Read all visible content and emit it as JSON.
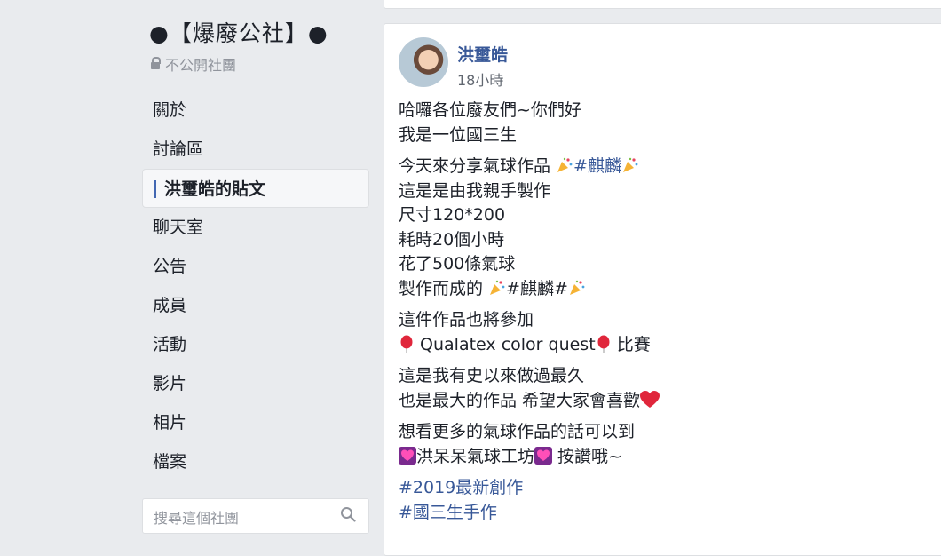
{
  "group": {
    "title": "●【爆廢公社】●",
    "privacy": "不公開社團"
  },
  "nav": {
    "items": [
      {
        "label": "關於"
      },
      {
        "label": "討論區"
      },
      {
        "label": "洪璽皓的貼文",
        "active": true
      },
      {
        "label": "聊天室"
      },
      {
        "label": "公告"
      },
      {
        "label": "成員"
      },
      {
        "label": "活動"
      },
      {
        "label": "影片"
      },
      {
        "label": "相片"
      },
      {
        "label": "檔案"
      }
    ]
  },
  "search": {
    "placeholder": "搜尋這個社團"
  },
  "post": {
    "author": "洪璽皓",
    "time": "18小時",
    "lines": {
      "l1": "哈囉各位廢友們~你們好",
      "l2": "我是一位國三生",
      "l3a": "今天來分享氣球作品 ",
      "l3b": "#麒麟",
      "l4": "這是是由我親手製作",
      "l5": "尺寸120*200",
      "l6": "耗時20個小時",
      "l7": "花了500條氣球",
      "l8a": "製作而成的 ",
      "l8b": "#麒麟#",
      "l9": "這件作品也將參加",
      "l10a": " Qualatex color quest",
      "l10b": " 比賽",
      "l11": "這是我有史以來做過最久",
      "l12a": "也是最大的作品 希望大家會喜歡",
      "l13": "想看更多的氣球作品的話可以到",
      "l14a": "洪呆呆氣球工坊",
      "l14b": " 按讚哦~",
      "tag1": "#2019最新創作",
      "tag2": "#國三生手作"
    }
  },
  "colors": {
    "background": "#e9ebee",
    "link": "#385898",
    "accent": "#4267b2"
  },
  "icons": [
    "lock-icon",
    "search-icon",
    "party-popper-icon",
    "balloon-icon",
    "heart-icon",
    "sparkle-heart-icon"
  ]
}
